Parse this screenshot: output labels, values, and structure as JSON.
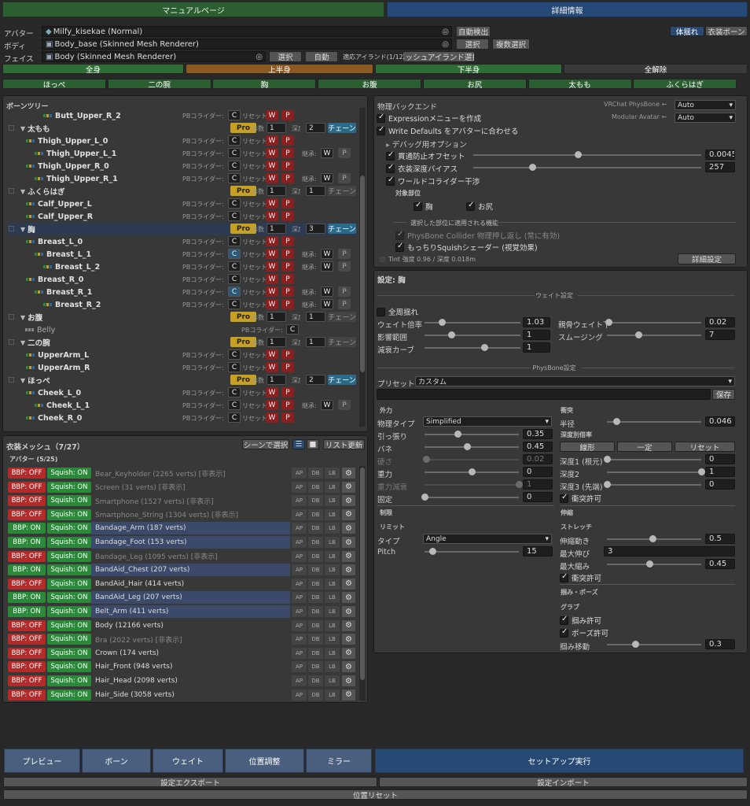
{
  "tabs": {
    "manual": "マニュアルページ",
    "details": "詳細情報"
  },
  "avatar": {
    "label": "アバター",
    "value": "Milfy_kisekae (Normal)",
    "auto": "自動検出"
  },
  "body": {
    "label": "ボディ",
    "value": "Body_base (Skinned Mesh Renderer)",
    "select": "選択",
    "multi": "複数選択"
  },
  "face": {
    "label": "フェイス",
    "value": "Body (Skinned Mesh Renderer)",
    "select": "選択",
    "auto": "自動",
    "island_count": "適応アイランド(1/123)",
    "island_select": "メッシュアイランド選択"
  },
  "modes": {
    "body_sway": "体揺れ",
    "cloth_bone": "衣装ボーン"
  },
  "region_row1": [
    "全身",
    "上半身",
    "下半身",
    "全解除"
  ],
  "region_row2": [
    "ほっぺ",
    "二の腕",
    "胸",
    "お腹",
    "お尻",
    "太もも",
    "ふくらはぎ"
  ],
  "bonetree": {
    "title": "ボーンツリー",
    "pb": "PBコライダー:",
    "reset": "リセット:",
    "inherit": "継承:",
    "C": "C",
    "W": "W",
    "P": "P",
    "pro": "Pro",
    "honsu": "本数",
    "shindo": "深度",
    "chain": "チェーン",
    "nodes": [
      {
        "name": "Butt_Upper_R_2",
        "t": "bone",
        "depth": 3
      },
      {
        "name": "太もも",
        "t": "group",
        "n": "1",
        "d": "2",
        "chain": true
      },
      {
        "name": "Thigh_Upper_L_0",
        "t": "bone",
        "depth": 1
      },
      {
        "name": "Thigh_Upper_L_1",
        "t": "bone",
        "depth": 2,
        "inh": true
      },
      {
        "name": "Thigh_Upper_R_0",
        "t": "bone",
        "depth": 1
      },
      {
        "name": "Thigh_Upper_R_1",
        "t": "bone",
        "depth": 2,
        "inh": true
      },
      {
        "name": "ふくらはぎ",
        "t": "group",
        "n": "1",
        "d": "1",
        "chain": false
      },
      {
        "name": "Calf_Upper_L",
        "t": "bone",
        "depth": 1
      },
      {
        "name": "Calf_Upper_R",
        "t": "bone",
        "depth": 1
      },
      {
        "name": "胸",
        "t": "group",
        "n": "1",
        "d": "3",
        "chain": true,
        "sel": true
      },
      {
        "name": "Breast_L_0",
        "t": "bone",
        "depth": 1
      },
      {
        "name": "Breast_L_1",
        "t": "bone",
        "depth": 2,
        "inh": true,
        "blue": true
      },
      {
        "name": "Breast_L_2",
        "t": "bone",
        "depth": 3,
        "inh": true
      },
      {
        "name": "Breast_R_0",
        "t": "bone",
        "depth": 1
      },
      {
        "name": "Breast_R_1",
        "t": "bone",
        "depth": 2,
        "inh": true,
        "blue": true
      },
      {
        "name": "Breast_R_2",
        "t": "bone",
        "depth": 3,
        "inh": true
      },
      {
        "name": "お腹",
        "t": "group",
        "n": "1",
        "d": "1",
        "chain": false
      },
      {
        "name": "Belly",
        "t": "belly"
      },
      {
        "name": "二の腕",
        "t": "group",
        "n": "1",
        "d": "1",
        "chain": false
      },
      {
        "name": "UpperArm_L",
        "t": "bone",
        "depth": 1
      },
      {
        "name": "UpperArm_R",
        "t": "bone",
        "depth": 1
      },
      {
        "name": "ほっぺ",
        "t": "group",
        "n": "1",
        "d": "2",
        "chain": true
      },
      {
        "name": "Cheek_L_0",
        "t": "bone",
        "depth": 1
      },
      {
        "name": "Cheek_L_1",
        "t": "bone",
        "depth": 2,
        "inh": true
      },
      {
        "name": "Cheek_R_0",
        "t": "bone",
        "depth": 1
      }
    ]
  },
  "meshes": {
    "title": "衣装メッシュ（7/27）",
    "scene_select": "シーンで選択",
    "refresh": "リスト更新",
    "avatar_header": "アバター (5/25)",
    "tags": [
      "AP",
      "DB",
      "LB"
    ],
    "bbp_on": "BBP: ON",
    "bbp_off": "BBP: OFF",
    "squish_on": "Squish: ON",
    "rows": [
      {
        "name": "Bear_Keyholder (2265 verts) [非表示]",
        "bbp": false,
        "vis": 0
      },
      {
        "name": "Screen (31 verts) [非表示]",
        "bbp": false,
        "vis": 0
      },
      {
        "name": "Smartphone (1527 verts) [非表示]",
        "bbp": false,
        "vis": 0
      },
      {
        "name": "Smartphone_String (1304 verts) [非表示]",
        "bbp": false,
        "vis": 0
      },
      {
        "name": "Bandage_Arm (187 verts)",
        "bbp": true,
        "vis": 1
      },
      {
        "name": "Bandage_Foot (153 verts)",
        "bbp": true,
        "vis": 1
      },
      {
        "name": "Bandage_Leg (1095 verts) [非表示]",
        "bbp": false,
        "vis": 0
      },
      {
        "name": "BandAid_Chest (207 verts)",
        "bbp": true,
        "vis": 1
      },
      {
        "name": "BandAid_Hair (414 verts)",
        "bbp": false,
        "vis": 2
      },
      {
        "name": "BandAid_Leg (207 verts)",
        "bbp": true,
        "vis": 1
      },
      {
        "name": "Belt_Arm (411 verts)",
        "bbp": true,
        "vis": 1
      },
      {
        "name": "Body (12166 verts)",
        "bbp": false,
        "vis": 2
      },
      {
        "name": "Bra (2022 verts) [非表示]",
        "bbp": false,
        "vis": 0
      },
      {
        "name": "Crown (174 verts)",
        "bbp": false,
        "vis": 2
      },
      {
        "name": "Hair_Front (948 verts)",
        "bbp": false,
        "vis": 2
      },
      {
        "name": "Hair_Head (2098 verts)",
        "bbp": false,
        "vis": 2
      },
      {
        "name": "Hair_Side (3058 verts)",
        "bbp": false,
        "vis": 2
      }
    ]
  },
  "physics": {
    "backend_label": "物理バックエンド",
    "vrchat_pb": "VRChat PhysBone ←",
    "modular_avatar": "Modular Avatar ←",
    "auto": "Auto",
    "expr_menu": "Expressionメニューを作成",
    "write_defaults": "Write Defaults をアバターに合わせる",
    "debug": "デバッグ用オプション",
    "pen_offset": "貫通防止オフセット",
    "pen_offset_v": "0.0045",
    "depth_bias": "衣装深度バイアス",
    "depth_bias_v": "257",
    "world_collider": "ワールドコライダー干渉",
    "target": "対象部位",
    "t_chest": "胸",
    "t_butt": "お尻",
    "applied": "選択した部位に適用される機能",
    "pb_collider": "PhysBone Collider 物理押し返し (常に有効)",
    "squish_shader": "もっちりSquishシェーダー (視覚効果)",
    "tint": "Tint 強度 0.96 / 深度 0.018m",
    "detail_btn": "詳細設定"
  },
  "settings": {
    "title": "設定: 胸",
    "weight_sec": "ウェイト設定",
    "full_sway": "全周揺れ",
    "weight_mul": "ウェイト倍率",
    "weight_mul_v": "1.03",
    "parent_weight": "親骨ウェイト下",
    "parent_weight_v": "0.02",
    "influence": "影響範囲",
    "influence_v": "1",
    "smoothing": "スムージング",
    "smoothing_v": "7",
    "falloff": "減衰カーブ",
    "falloff_v": "1",
    "pb_sec": "PhysBone設定",
    "preset": "プリセット",
    "preset_v": "カスタム",
    "save": "保存",
    "force": "外力",
    "phys_type": "物理タイプ",
    "phys_type_v": "Simplified",
    "pull": "引っ張り",
    "pull_v": "0.35",
    "spring": "バネ",
    "spring_v": "0.45",
    "stiff": "硬さ",
    "stiff_v": "0.02",
    "gravity": "重力",
    "gravity_v": "0",
    "grav_falloff": "重力減衰",
    "grav_falloff_v": "1",
    "immobile": "固定",
    "immobile_v": "0",
    "limit": "制限",
    "limit2": "リミット",
    "type": "タイプ",
    "type_v": "Angle",
    "pitch": "Pitch",
    "pitch_v": "15",
    "collision": "衝突",
    "radius": "半径",
    "radius_v": "0.046",
    "depth_mul": "深度別倍率",
    "linear": "線形",
    "const": "一定",
    "reset": "リセット",
    "d1": "深度1 (根元)",
    "d1_v": "0",
    "d2": "深度2",
    "d2_v": "1",
    "d3": "深度3 (先端)",
    "d3_v": "0",
    "allow_coll": "衝突許可",
    "stretch_sec": "伸縮",
    "stretch": "ストレッチ",
    "stretch_mv": "伸縮動き",
    "stretch_mv_v": "0.5",
    "max_stretch": "最大伸び",
    "max_stretch_v": "3",
    "max_squish": "最大縮み",
    "max_squish_v": "0.45",
    "allow_coll2": "衝突許可",
    "grab_sec": "掴み・ポーズ",
    "grab": "グラブ",
    "allow_grab": "掴み許可",
    "allow_pose": "ポーズ許可",
    "grab_move": "掴み移動",
    "grab_move_v": "0.3"
  },
  "footer": {
    "tabs": [
      "プレビュー",
      "ボーン",
      "ウェイト",
      "位置調整",
      "ミラー"
    ],
    "execute": "セットアップ実行",
    "export": "設定エクスポート",
    "import": "設定インポート",
    "pos_reset": "位置リセット"
  },
  "colors": {
    "green": "#2e6e36",
    "blue": "#2e5a8e",
    "orange": "#8a5a22",
    "bbp_off": "#b22a2a",
    "bbp_on": "#2a8a3a"
  }
}
